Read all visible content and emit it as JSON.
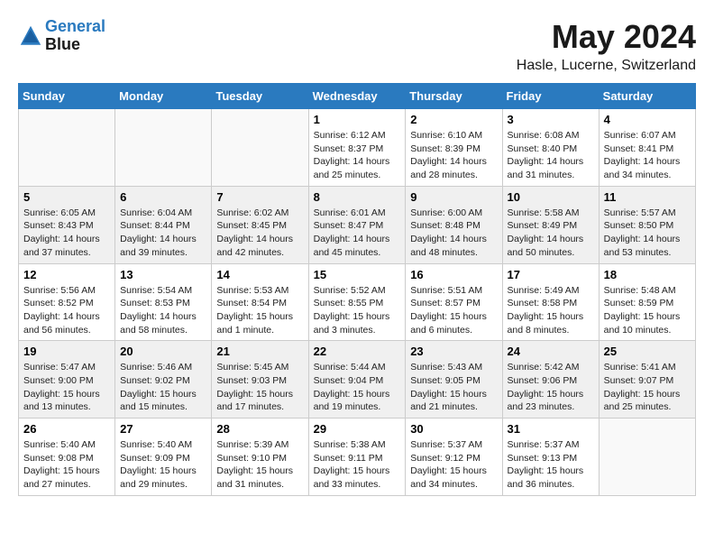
{
  "header": {
    "logo_line1": "General",
    "logo_line2": "Blue",
    "month": "May 2024",
    "location": "Hasle, Lucerne, Switzerland"
  },
  "days_of_week": [
    "Sunday",
    "Monday",
    "Tuesday",
    "Wednesday",
    "Thursday",
    "Friday",
    "Saturday"
  ],
  "weeks": [
    [
      {
        "day": "",
        "text": ""
      },
      {
        "day": "",
        "text": ""
      },
      {
        "day": "",
        "text": ""
      },
      {
        "day": "1",
        "text": "Sunrise: 6:12 AM\nSunset: 8:37 PM\nDaylight: 14 hours and 25 minutes."
      },
      {
        "day": "2",
        "text": "Sunrise: 6:10 AM\nSunset: 8:39 PM\nDaylight: 14 hours and 28 minutes."
      },
      {
        "day": "3",
        "text": "Sunrise: 6:08 AM\nSunset: 8:40 PM\nDaylight: 14 hours and 31 minutes."
      },
      {
        "day": "4",
        "text": "Sunrise: 6:07 AM\nSunset: 8:41 PM\nDaylight: 14 hours and 34 minutes."
      }
    ],
    [
      {
        "day": "5",
        "text": "Sunrise: 6:05 AM\nSunset: 8:43 PM\nDaylight: 14 hours and 37 minutes."
      },
      {
        "day": "6",
        "text": "Sunrise: 6:04 AM\nSunset: 8:44 PM\nDaylight: 14 hours and 39 minutes."
      },
      {
        "day": "7",
        "text": "Sunrise: 6:02 AM\nSunset: 8:45 PM\nDaylight: 14 hours and 42 minutes."
      },
      {
        "day": "8",
        "text": "Sunrise: 6:01 AM\nSunset: 8:47 PM\nDaylight: 14 hours and 45 minutes."
      },
      {
        "day": "9",
        "text": "Sunrise: 6:00 AM\nSunset: 8:48 PM\nDaylight: 14 hours and 48 minutes."
      },
      {
        "day": "10",
        "text": "Sunrise: 5:58 AM\nSunset: 8:49 PM\nDaylight: 14 hours and 50 minutes."
      },
      {
        "day": "11",
        "text": "Sunrise: 5:57 AM\nSunset: 8:50 PM\nDaylight: 14 hours and 53 minutes."
      }
    ],
    [
      {
        "day": "12",
        "text": "Sunrise: 5:56 AM\nSunset: 8:52 PM\nDaylight: 14 hours and 56 minutes."
      },
      {
        "day": "13",
        "text": "Sunrise: 5:54 AM\nSunset: 8:53 PM\nDaylight: 14 hours and 58 minutes."
      },
      {
        "day": "14",
        "text": "Sunrise: 5:53 AM\nSunset: 8:54 PM\nDaylight: 15 hours and 1 minute."
      },
      {
        "day": "15",
        "text": "Sunrise: 5:52 AM\nSunset: 8:55 PM\nDaylight: 15 hours and 3 minutes."
      },
      {
        "day": "16",
        "text": "Sunrise: 5:51 AM\nSunset: 8:57 PM\nDaylight: 15 hours and 6 minutes."
      },
      {
        "day": "17",
        "text": "Sunrise: 5:49 AM\nSunset: 8:58 PM\nDaylight: 15 hours and 8 minutes."
      },
      {
        "day": "18",
        "text": "Sunrise: 5:48 AM\nSunset: 8:59 PM\nDaylight: 15 hours and 10 minutes."
      }
    ],
    [
      {
        "day": "19",
        "text": "Sunrise: 5:47 AM\nSunset: 9:00 PM\nDaylight: 15 hours and 13 minutes."
      },
      {
        "day": "20",
        "text": "Sunrise: 5:46 AM\nSunset: 9:02 PM\nDaylight: 15 hours and 15 minutes."
      },
      {
        "day": "21",
        "text": "Sunrise: 5:45 AM\nSunset: 9:03 PM\nDaylight: 15 hours and 17 minutes."
      },
      {
        "day": "22",
        "text": "Sunrise: 5:44 AM\nSunset: 9:04 PM\nDaylight: 15 hours and 19 minutes."
      },
      {
        "day": "23",
        "text": "Sunrise: 5:43 AM\nSunset: 9:05 PM\nDaylight: 15 hours and 21 minutes."
      },
      {
        "day": "24",
        "text": "Sunrise: 5:42 AM\nSunset: 9:06 PM\nDaylight: 15 hours and 23 minutes."
      },
      {
        "day": "25",
        "text": "Sunrise: 5:41 AM\nSunset: 9:07 PM\nDaylight: 15 hours and 25 minutes."
      }
    ],
    [
      {
        "day": "26",
        "text": "Sunrise: 5:40 AM\nSunset: 9:08 PM\nDaylight: 15 hours and 27 minutes."
      },
      {
        "day": "27",
        "text": "Sunrise: 5:40 AM\nSunset: 9:09 PM\nDaylight: 15 hours and 29 minutes."
      },
      {
        "day": "28",
        "text": "Sunrise: 5:39 AM\nSunset: 9:10 PM\nDaylight: 15 hours and 31 minutes."
      },
      {
        "day": "29",
        "text": "Sunrise: 5:38 AM\nSunset: 9:11 PM\nDaylight: 15 hours and 33 minutes."
      },
      {
        "day": "30",
        "text": "Sunrise: 5:37 AM\nSunset: 9:12 PM\nDaylight: 15 hours and 34 minutes."
      },
      {
        "day": "31",
        "text": "Sunrise: 5:37 AM\nSunset: 9:13 PM\nDaylight: 15 hours and 36 minutes."
      },
      {
        "day": "",
        "text": ""
      }
    ]
  ]
}
